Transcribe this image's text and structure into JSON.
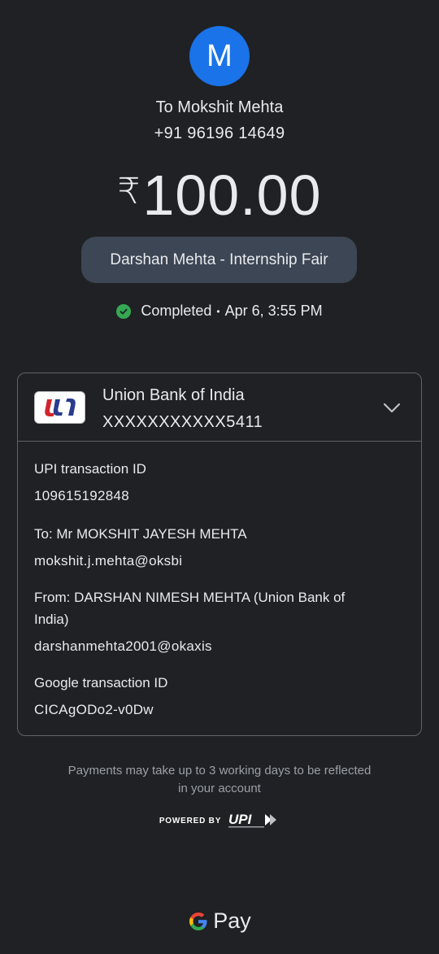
{
  "recipient": {
    "avatar_initial": "M",
    "to_label": "To Mokshit Mehta",
    "phone": "+91 96196 14649"
  },
  "payment": {
    "currency_symbol": "₹",
    "amount": "100.00",
    "note": "Darshan Mehta - Internship Fair",
    "status": "Completed",
    "separator": "•",
    "datetime": "Apr 6, 3:55 PM"
  },
  "bank": {
    "name": "Union Bank of India",
    "account": "XXXXXXXXXXX5411"
  },
  "details": {
    "upi_label": "UPI transaction ID",
    "upi_value": "109615192848",
    "to_label": "To: Mr MOKSHIT JAYESH MEHTA",
    "to_value": "mokshit.j.mehta@oksbi",
    "from_label_line1": "From: DARSHAN NIMESH MEHTA (Union Bank of",
    "from_label_line2": "India)",
    "from_value": "darshanmehta2001@okaxis",
    "google_label": "Google transaction ID",
    "google_value": "CICAgODo2-v0Dw"
  },
  "footer": {
    "note_line1": "Payments may take up to 3 working days to be reflected",
    "note_line2": "in your account",
    "powered_by": "POWERED BY",
    "upi_logo_text": "UPI",
    "brand": "Pay"
  },
  "colors": {
    "background": "#202124",
    "avatar": "#1a73e8",
    "pill": "#3c4654",
    "success": "#34a853",
    "border": "#5f6368",
    "bank_logo_red": "#d0242b",
    "bank_logo_blue": "#2a3b8f"
  },
  "icons": [
    "check-icon",
    "chevron-down-icon",
    "union-bank-logo-icon",
    "upi-logo-icon",
    "google-g-icon"
  ]
}
